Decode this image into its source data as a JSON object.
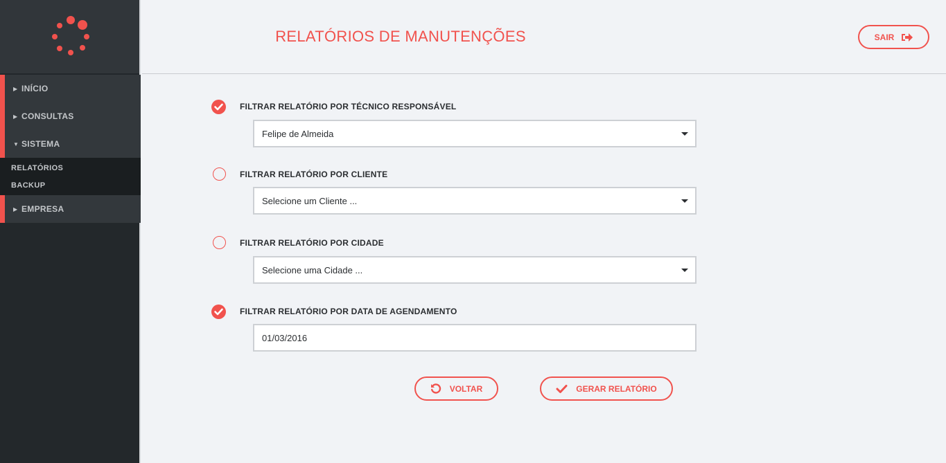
{
  "brand": {
    "accent": "#f1524d",
    "sidebar_bg": "#23282b"
  },
  "sidebar": {
    "items": [
      {
        "label": "INÍCIO"
      },
      {
        "label": "CONSULTAS"
      },
      {
        "label": "SISTEMA"
      },
      {
        "label": "EMPRESA"
      }
    ],
    "subitems": [
      {
        "label": "RELATÓRIOS"
      },
      {
        "label": "BACKUP"
      }
    ]
  },
  "header": {
    "title": "RELATÓRIOS DE MANUTENÇÕES",
    "logout_label": "SAIR"
  },
  "filters": [
    {
      "label": "FILTRAR RELATÓRIO POR TÉCNICO RESPONSÁVEL",
      "checked": true,
      "value": "Felipe de Almeida",
      "type": "select"
    },
    {
      "label": "FILTRAR RELATÓRIO POR CLIENTE",
      "checked": false,
      "value": "Selecione um Cliente ...",
      "type": "select"
    },
    {
      "label": "FILTRAR RELATÓRIO POR CIDADE",
      "checked": false,
      "value": "Selecione uma Cidade ...",
      "type": "select"
    },
    {
      "label": "FILTRAR RELATÓRIO POR DATA DE AGENDAMENTO",
      "checked": true,
      "value": "01/03/2016",
      "type": "input"
    }
  ],
  "actions": {
    "back_label": "VOLTAR",
    "generate_label": "GERAR RELATÓRIO"
  }
}
